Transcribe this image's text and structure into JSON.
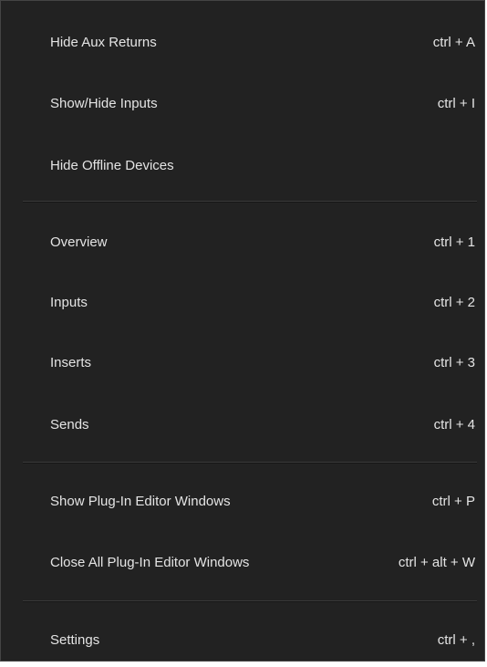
{
  "menu": {
    "items": [
      {
        "label": "Hide Aux Returns",
        "shortcut": "ctrl + A"
      },
      {
        "label": "Show/Hide Inputs",
        "shortcut": "ctrl + I"
      },
      {
        "label": "Hide Offline Devices",
        "shortcut": ""
      },
      {
        "label": "Overview",
        "shortcut": "ctrl + 1"
      },
      {
        "label": "Inputs",
        "shortcut": "ctrl + 2"
      },
      {
        "label": "Inserts",
        "shortcut": "ctrl + 3"
      },
      {
        "label": "Sends",
        "shortcut": "ctrl + 4"
      },
      {
        "label": "Show Plug-In Editor Windows",
        "shortcut": "ctrl + P"
      },
      {
        "label": "Close All Plug-In Editor Windows",
        "shortcut": "ctrl + alt + W"
      },
      {
        "label": "Settings",
        "shortcut": "ctrl + ,"
      }
    ]
  },
  "colors": {
    "background": "#222222",
    "text": "#e4e4e4",
    "separator": "#3a3a3a"
  }
}
